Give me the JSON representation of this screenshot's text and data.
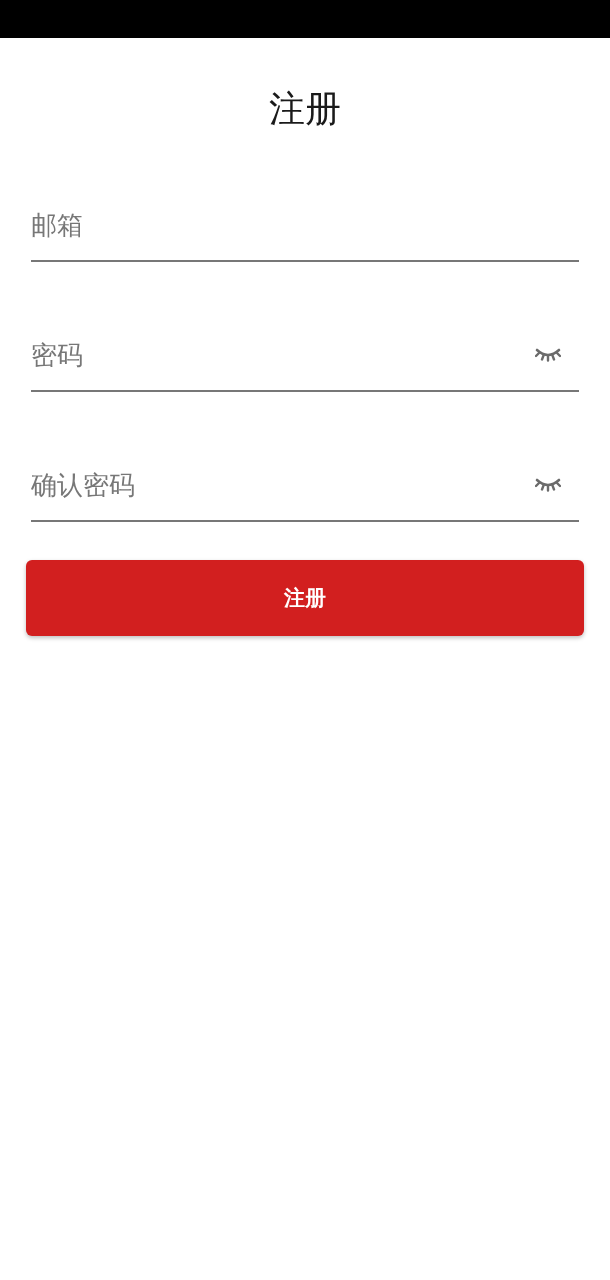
{
  "title": "注册",
  "fields": [
    {
      "kind": "text",
      "placeholder": "邮箱"
    },
    {
      "kind": "password",
      "placeholder": "密码"
    },
    {
      "kind": "password",
      "placeholder": "确认密码"
    }
  ],
  "submit_button": "注册"
}
